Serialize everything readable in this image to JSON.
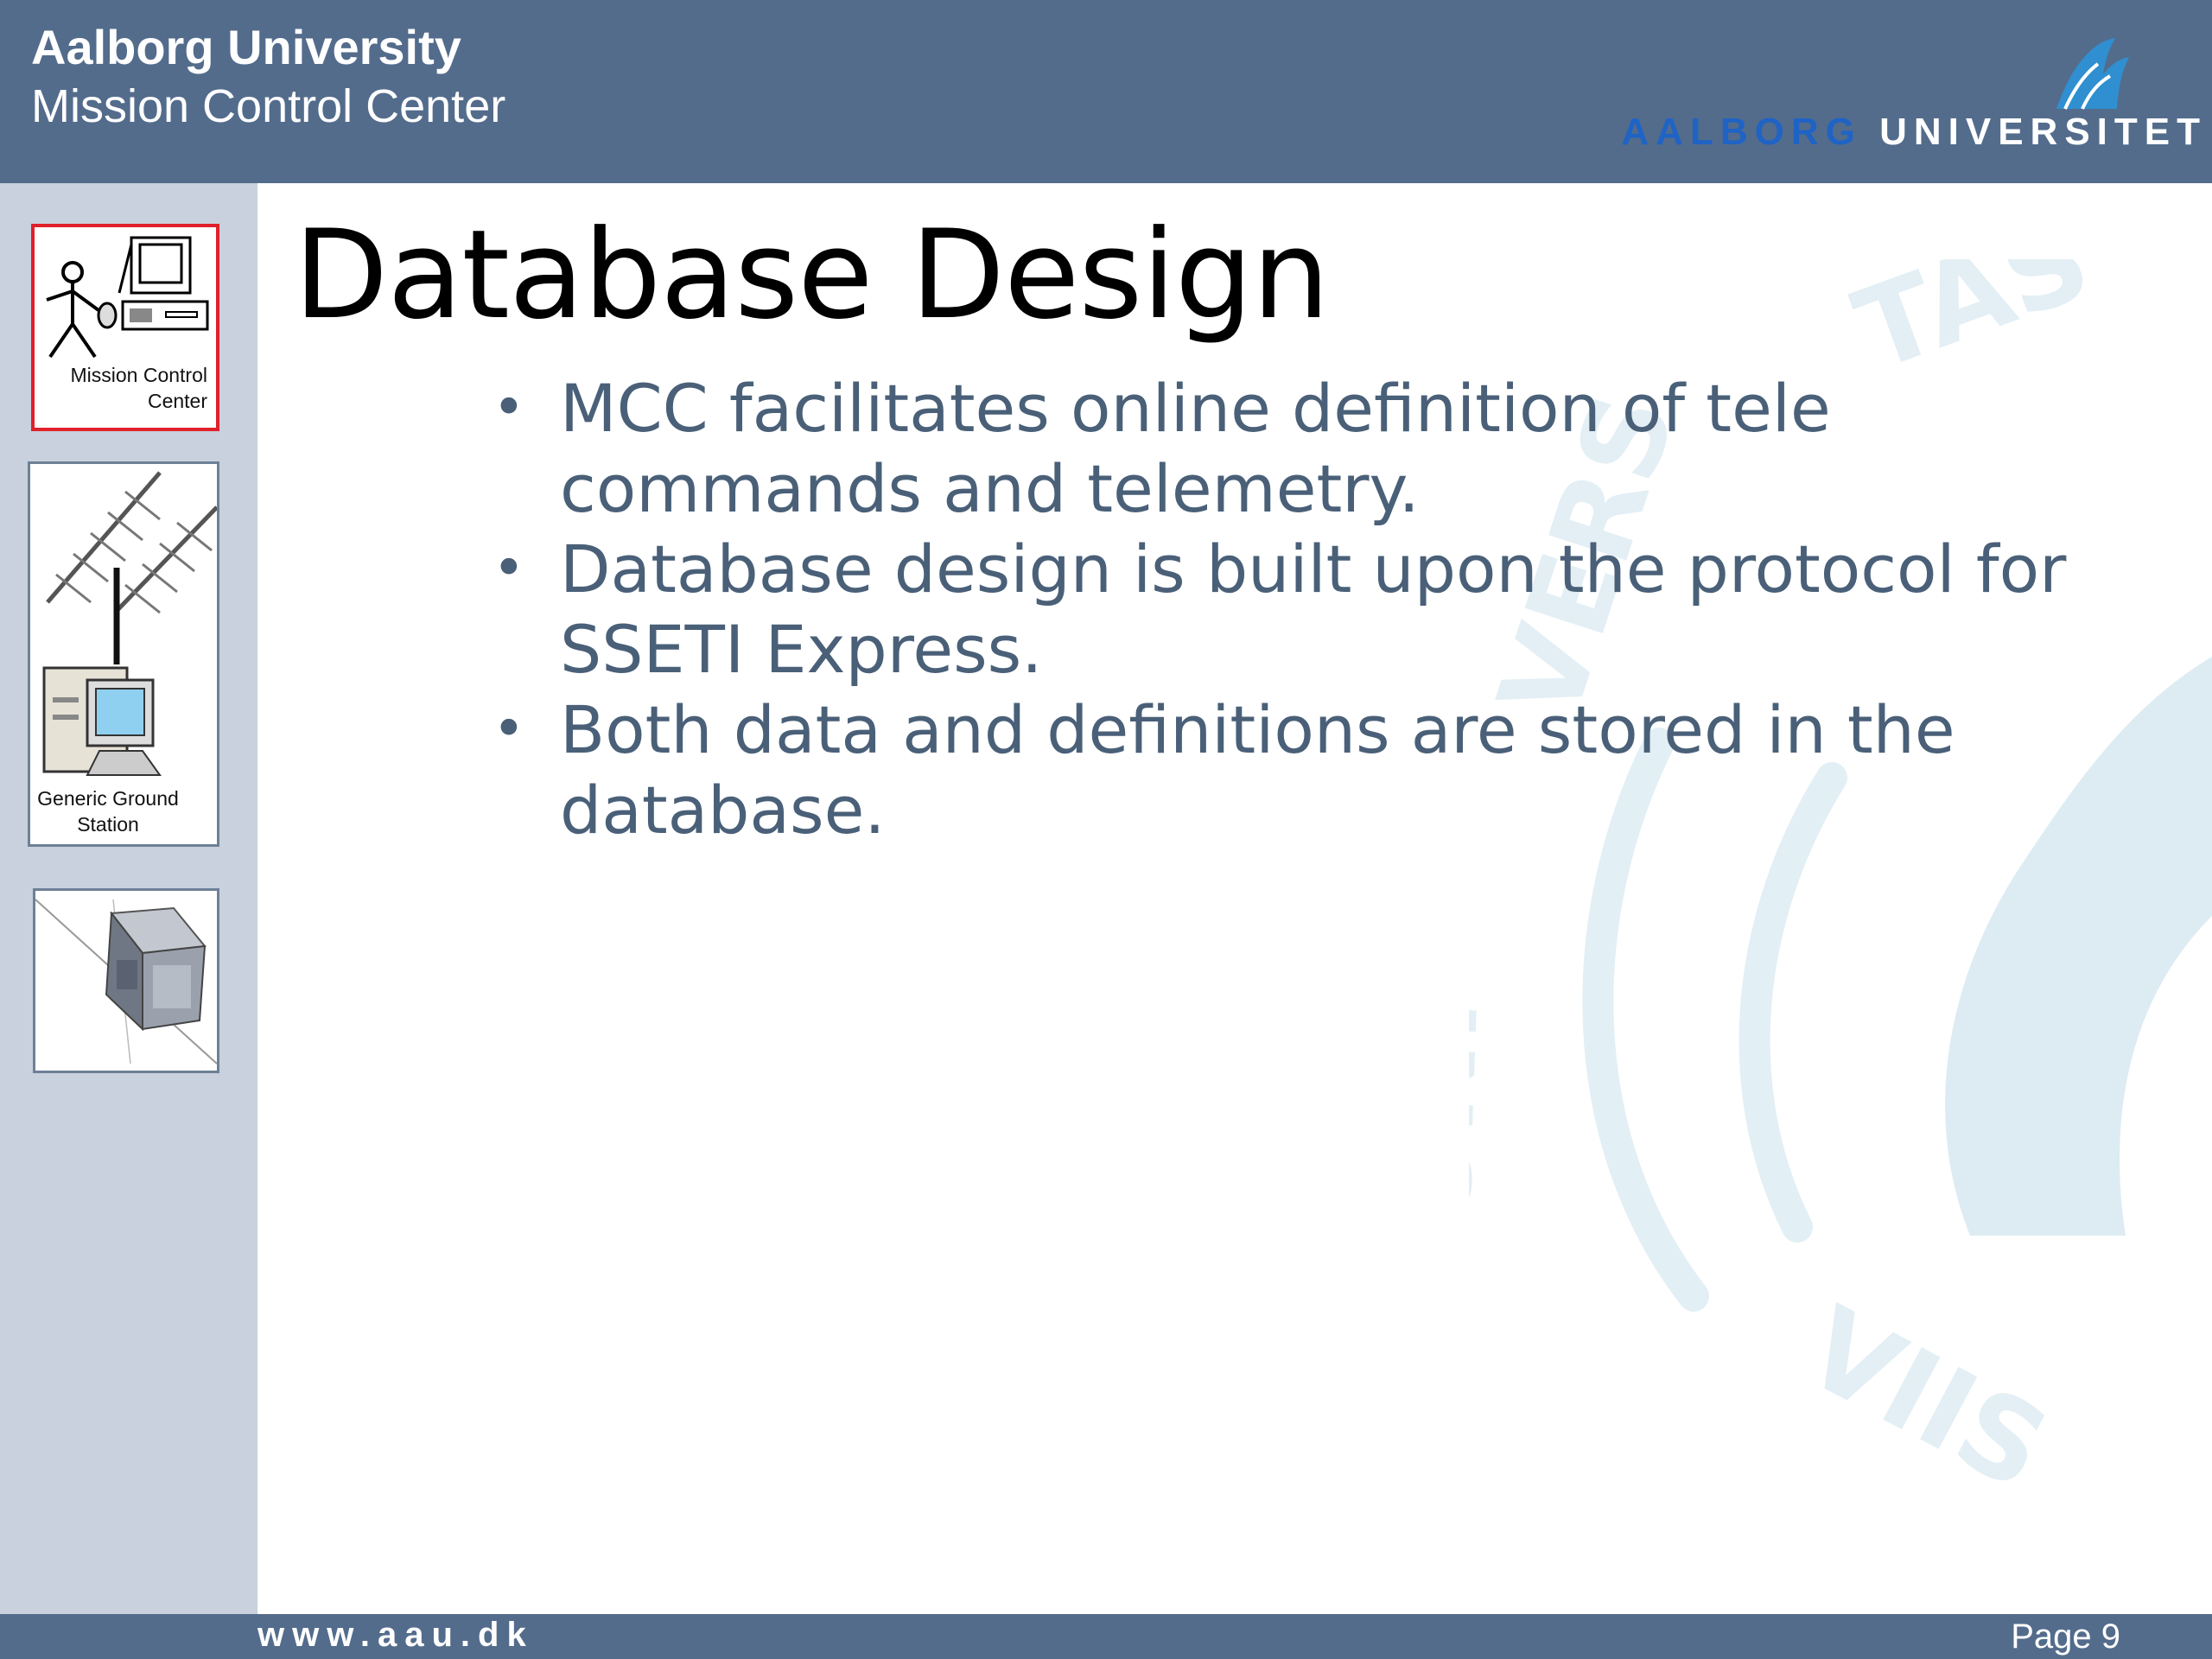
{
  "header": {
    "line1": "Aalborg University",
    "line2": "Mission Control Center",
    "logo": {
      "icon": "aau-logo-icon",
      "word1": "AALBORG",
      "word2": "UNIVERSITET",
      "word1_color": "#1f63c5"
    }
  },
  "sidebar": {
    "thumbnails": [
      {
        "label_line1": "Mission Control",
        "label_line2": "Center",
        "icon": "mission-control-icon",
        "active": true,
        "border_color": "#e0202a"
      },
      {
        "label_line1": "Generic Ground",
        "label_line2": "Station",
        "icon": "ground-station-icon",
        "active": false
      },
      {
        "icon": "satellite-icon",
        "active": false
      }
    ]
  },
  "slide": {
    "title": "Database Design",
    "bullets": [
      "MCC facilitates online definition of tele commands and telemetry.",
      "Database design is built upon the protocol for SSETI Express.",
      "Both data and definitions are stored in the database."
    ],
    "bullet_glyph": "•"
  },
  "footer": {
    "url": "www.aau.dk",
    "page": "Page 9"
  },
  "colors": {
    "header_bg": "#536c8c",
    "sidebar_bg": "#c8d1dd",
    "bullet_text": "#4a6078",
    "watermark": "#dcecf2"
  }
}
